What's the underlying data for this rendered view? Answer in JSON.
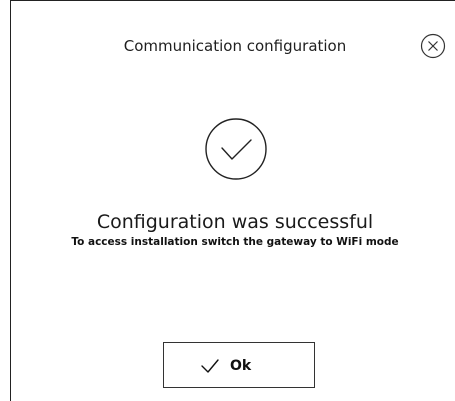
{
  "dialog": {
    "title": "Communication configuration",
    "close_icon": "close-circle-icon"
  },
  "status": {
    "icon": "check-circle-icon",
    "heading": "Configuration was successful",
    "message": "To access installation switch the gateway to WiFi mode"
  },
  "actions": {
    "ok_label": "Ok",
    "ok_icon": "check-icon"
  }
}
